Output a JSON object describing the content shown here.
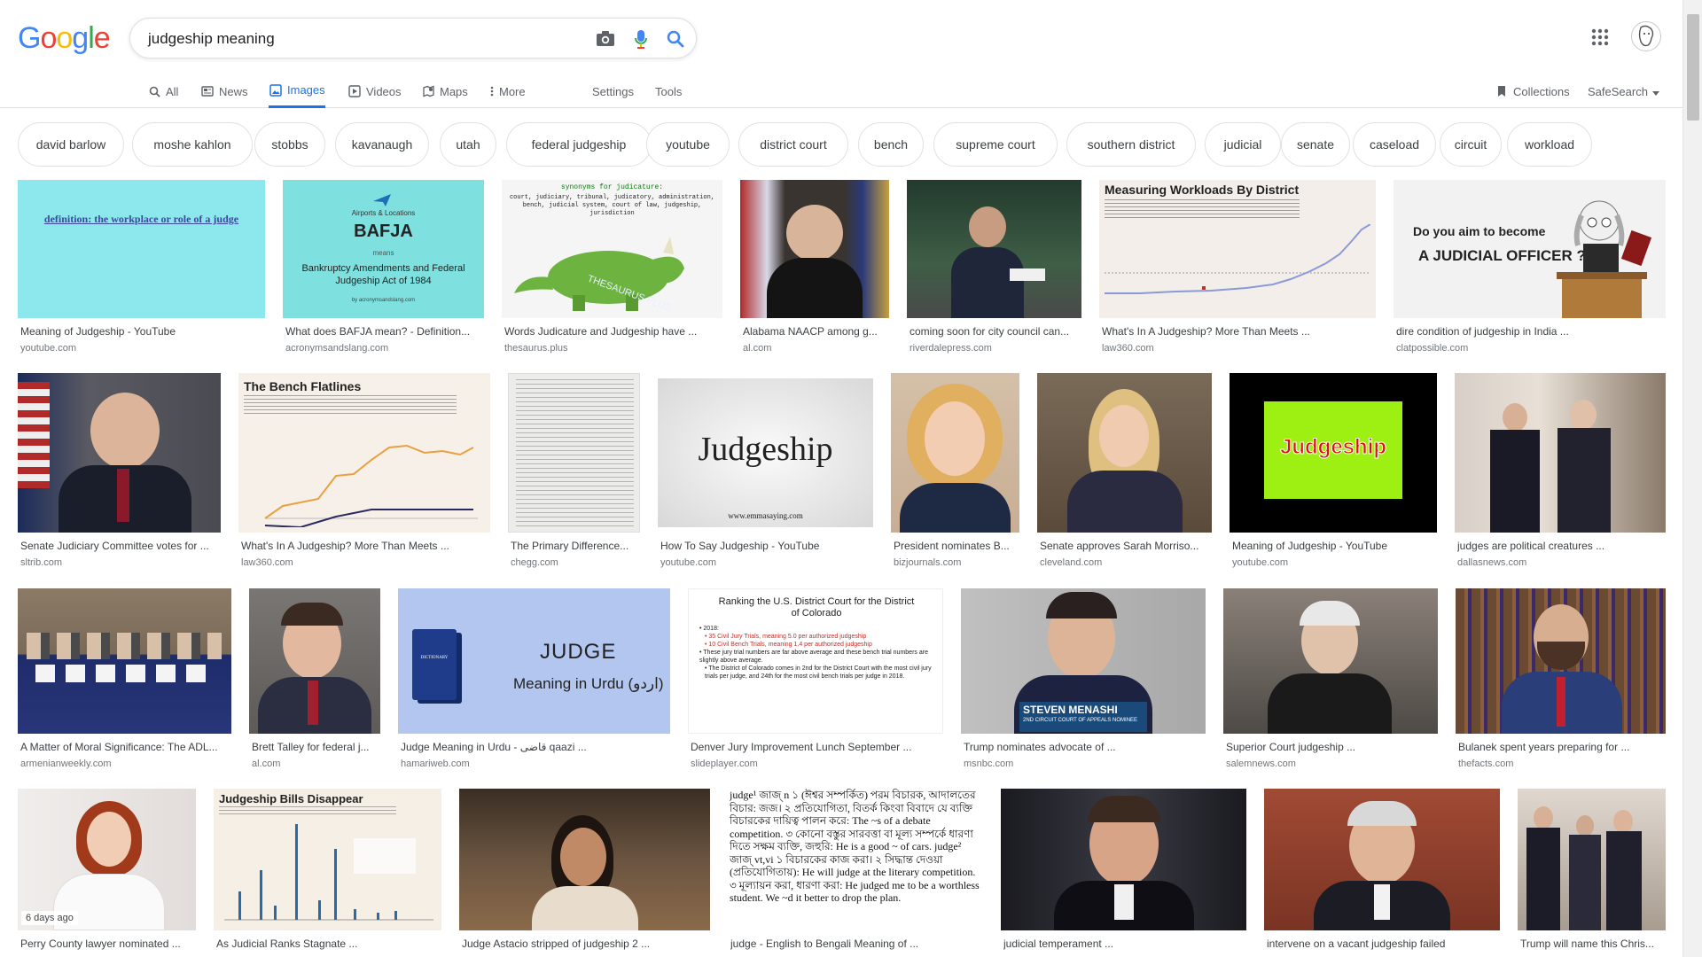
{
  "logo_text": "Google",
  "search": {
    "query": "judgeship meaning"
  },
  "tabs": [
    {
      "label": "All",
      "icon": "search-icon"
    },
    {
      "label": "News",
      "icon": "news-icon"
    },
    {
      "label": "Images",
      "icon": "images-icon",
      "active": true
    },
    {
      "label": "Videos",
      "icon": "play-icon"
    },
    {
      "label": "Maps",
      "icon": "map-pin-icon"
    },
    {
      "label": "More",
      "icon": "more-vert-icon"
    }
  ],
  "tools": {
    "settings": "Settings",
    "tools": "Tools",
    "collections": "Collections",
    "safesearch": "SafeSearch"
  },
  "chips": [
    "david barlow",
    "moshe kahlon",
    "stobbs",
    "kavanaugh",
    "utah",
    "federal judgeship",
    "youtube",
    "district court",
    "bench",
    "supreme court",
    "southern district",
    "judicial",
    "senate",
    "caseload",
    "circuit",
    "workload"
  ],
  "results": [
    {
      "title": "Meaning of Judgeship - YouTube",
      "source": "youtube.com",
      "thumb_text": "definition: the workplace or role of a judge",
      "color": "#8de8ee"
    },
    {
      "title": "What does BAFJA mean? - Definition...",
      "source": "acronymsandslang.com",
      "thumb_text": "BAFJA",
      "thumb_sub": "Bankruptcy Amendments and Federal Judgeship Act of 1984",
      "thumb_top": "Airports & Locations",
      "thumb_means": "means",
      "thumb_site": "by acronymsandslang.com",
      "color": "#7fe0e0"
    },
    {
      "title": "Words Judicature and Judgeship have ...",
      "source": "thesaurus.plus",
      "thumb_text": "synonyms for judicature:",
      "thumb_sub": "court, judiciary, tribunal, judicatory, administration, bench, judicial system, court of law, judgeship, jurisdiction",
      "color": "#f5f5f5"
    },
    {
      "title": "Alabama NAACP among g...",
      "source": "al.com",
      "color": "#3a3430"
    },
    {
      "title": "coming soon for city council can...",
      "source": "riverdalepress.com",
      "color": "#2f4a3a"
    },
    {
      "title": "What's In A Judgeship? More Than Meets ...",
      "source": "law360.com",
      "thumb_text": "Measuring Workloads By District",
      "color": "#f4eeea"
    },
    {
      "title": "dire condition of judgeship in India ...",
      "source": "clatpossible.com",
      "thumb_text": "Do you aim to become",
      "thumb_sub": "A JUDICIAL OFFICER ?",
      "color": "#f2f2f2"
    },
    {
      "title": "Senate Judiciary Committee votes for ...",
      "source": "sltrib.com",
      "color": "#5a5a62"
    },
    {
      "title": "What's In A Judgeship? More Than Meets ...",
      "source": "law360.com",
      "thumb_text": "The Bench Flatlines",
      "color": "#f7f0e8"
    },
    {
      "title": "The Primary Difference...",
      "source": "chegg.com",
      "color": "#ececea"
    },
    {
      "title": "How To Say Judgeship - YouTube",
      "source": "youtube.com",
      "thumb_text": "Judgeship",
      "thumb_sub": "www.emmasaying.com",
      "color": "#e6e6e6"
    },
    {
      "title": "President nominates B...",
      "source": "bizjournals.com",
      "color": "#c9a483"
    },
    {
      "title": "Senate approves Sarah Morriso...",
      "source": "cleveland.com",
      "color": "#6a5a4a"
    },
    {
      "title": "Meaning of Judgeship - YouTube",
      "source": "youtube.com",
      "thumb_text": "Judgeship",
      "color": "#000000"
    },
    {
      "title": "judges are political creatures ...",
      "source": "dallasnews.com",
      "color": "#8a7a6a"
    },
    {
      "title": "A Matter of Moral Significance: The ADL...",
      "source": "armenianweekly.com",
      "color": "#7a6a58"
    },
    {
      "title": "Brett Talley for federal j...",
      "source": "al.com",
      "color": "#5e5a58"
    },
    {
      "title": "Judge Meaning in Urdu - قاضی qaazi ...",
      "source": "hamariweb.com",
      "thumb_text": "JUDGE",
      "thumb_sub": "Meaning in Urdu (اردو)",
      "thumb_book": "DICTIONARY",
      "color": "#b3c6f0"
    },
    {
      "title": "Denver Jury Improvement Lunch September ...",
      "source": "slideplayer.com",
      "thumb_text": "Ranking the U.S. District Court for the District of Colorado",
      "thumb_lines": [
        "• 2018:",
        "  • 35 Civil Jury Trials, meaning 5.0 per authorized judgeship",
        "  • 10 Civil Bench Trials, meaning 1.4 per authorized judgeship",
        "• These jury trial numbers are far above average and these bench trial numbers are slightly above average.",
        "• The District of Colorado comes in 2nd for the District Court with the most civil jury trials per judge, and 24th for the most civil bench trials per judge in 2018."
      ],
      "color": "#ffffff"
    },
    {
      "title": "Trump nominates advocate of ...",
      "source": "msnbc.com",
      "thumb_text": "STEVEN MENASHI",
      "thumb_sub": "2ND CIRCUIT COURT OF APPEALS NOMINEE",
      "color": "#b7b7b7"
    },
    {
      "title": "Superior Court judgeship ...",
      "source": "salemnews.com",
      "color": "#4e4a46"
    },
    {
      "title": "Bulanek spent years preparing for ...",
      "source": "thefacts.com",
      "color": "#6a4a32"
    },
    {
      "title": "Perry County lawyer nominated ...",
      "source": "",
      "badge": "6 days ago",
      "color": "#e8e4e2"
    },
    {
      "title": "As Judicial Ranks Stagnate ...",
      "source": "",
      "thumb_text": "Judgeship Bills Disappear",
      "color": "#f5efe6"
    },
    {
      "title": "Judge Astacio stripped of judgeship 2 ...",
      "source": "",
      "color": "#5a4a3a"
    },
    {
      "title": "judge - English to Bengali Meaning of ...",
      "source": "",
      "thumb_text": "judge¹ জাজ্ n ১ (ঈশ্বর সম্পর্কিত) পরম বিচারক, আদালতের বিচার: জজ। ২ প্রতিযোগিতা, বিতর্ক কিংবা বিবাদে যে ব্যক্তি বিচারকের দায়িত্ব পালন করে: The ~s of a debate competition. ৩ কোনো বস্তুর সারবত্তা বা মূল্য সম্পর্কে ধারণা দিতে সক্ষম ব্যক্তি, জহুরি: He is a good ~ of cars. judge² জাজ্ vt,vi ১ বিচারকের কাজ করা। ২ সিদ্ধান্ত দেওয়া (প্রতিযোগিতায়): He will judge at the literary competition. ৩ মূল্যায়ন করা, ধারণা করা: He judged me to be a worthless student. We ~d it better to drop the plan.",
      "color": "#ffffff"
    },
    {
      "title": "judicial temperament ...",
      "source": "",
      "color": "#2a2a30"
    },
    {
      "title": "intervene on a vacant judgeship failed",
      "source": "",
      "color": "#8a4a3a"
    },
    {
      "title": "Trump will name this Chris...",
      "source": "",
      "color": "#9a9088"
    }
  ]
}
